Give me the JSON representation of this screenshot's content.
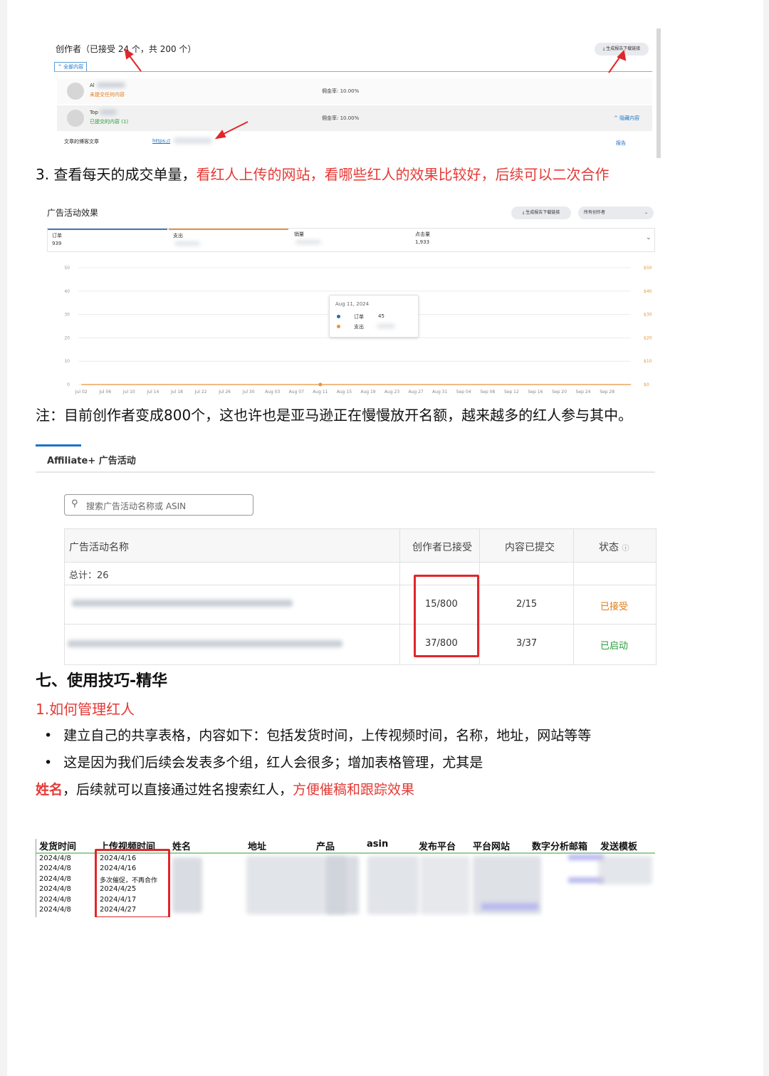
{
  "creators_panel": {
    "title": "创作者（已接受 24 个，共 200 个）",
    "report_button": "生成报告下载链接",
    "filter_tab": "^ 全部内容",
    "rows": [
      {
        "name": "Al",
        "status": "未提交任何内容",
        "commission": "佣金率: 10.00%"
      },
      {
        "name": "Top",
        "status": "已提交的内容 (1)",
        "commission": "佣金率: 10.00%",
        "action": "^ 隐藏内容"
      }
    ],
    "article_label": "文章的博客文章",
    "article_link": "https://",
    "article_action": "报告"
  },
  "section3_text": {
    "prefix": "3. 查看每天的成交单量，",
    "red": "看红人上传的网站，看哪些红人的效果比较好，后续可以二次合作"
  },
  "chart_panel": {
    "title": "广告活动效果",
    "report_button": "生成报告下载链接",
    "creator_select": "所有创作者",
    "metrics": [
      {
        "label": "订单",
        "value": "939"
      },
      {
        "label": "支出",
        "value": ""
      },
      {
        "label": "销量",
        "value": ""
      },
      {
        "label": "点击量",
        "value": "1,933"
      }
    ],
    "tooltip": {
      "date": "Aug 11, 2024",
      "series1": "订单",
      "value1": "45",
      "series2": "支出"
    }
  },
  "chart_data": {
    "type": "bar",
    "title": "广告活动效果",
    "x_tick_labels": [
      "Jul 02",
      "Jul 06",
      "Jul 10",
      "Jul 14",
      "Jul 18",
      "Jul 22",
      "Jul 26",
      "Jul 30",
      "Aug 03",
      "Aug 07",
      "Aug 11",
      "Aug 15",
      "Aug 19",
      "Aug 23",
      "Aug 27",
      "Aug 31",
      "Sep 04",
      "Sep 08",
      "Sep 12",
      "Sep 16",
      "Sep 20",
      "Sep 24",
      "Sep 28"
    ],
    "y_left_ticks": [
      "0",
      "10",
      "20",
      "30",
      "40",
      "50"
    ],
    "y_right_ticks": [
      "$0",
      "$10",
      "$20",
      "$30",
      "$40",
      "$50"
    ],
    "ylim": [
      0,
      50
    ],
    "series": [
      {
        "name": "订单",
        "kind": "bar",
        "color": "#8fb3cf",
        "values": [
          0,
          0,
          0,
          0,
          0,
          0,
          0,
          0,
          0,
          0,
          0,
          0,
          0,
          0,
          0,
          0,
          0,
          0,
          0,
          0,
          0,
          0,
          0,
          0,
          0,
          0,
          0,
          0,
          0,
          0,
          0,
          0,
          0,
          0,
          0,
          0,
          0,
          0,
          0,
          0,
          0,
          0,
          0,
          0,
          0,
          0,
          0,
          0,
          0,
          0,
          0,
          0,
          0,
          0,
          0,
          0,
          0,
          0,
          0,
          0,
          0,
          0,
          0,
          0,
          0,
          0,
          0,
          0,
          0,
          0,
          0,
          0,
          0,
          0,
          0,
          0,
          0,
          0,
          0,
          0,
          0,
          0,
          0,
          0,
          0,
          0,
          0,
          0,
          0,
          0,
          0,
          0
        ]
      },
      {
        "name": "支出",
        "kind": "line",
        "color": "#e8953a",
        "values": [
          0,
          0,
          0,
          0,
          0,
          0,
          0,
          0,
          0,
          0,
          0,
          0,
          0,
          0,
          0,
          0,
          0,
          0,
          0,
          0,
          0,
          0,
          0,
          0,
          0,
          0,
          0,
          0,
          0,
          0,
          0,
          0,
          0,
          0,
          0,
          0,
          0,
          0,
          0,
          0,
          0,
          0,
          0,
          0,
          0,
          0,
          0,
          0,
          0,
          0,
          0,
          0,
          0,
          0,
          0,
          0,
          0,
          0,
          0,
          0,
          0,
          0,
          0,
          0,
          0,
          0,
          0,
          0,
          0,
          0,
          0,
          0,
          0,
          0,
          0,
          0,
          0,
          0,
          0,
          0,
          0,
          0,
          0,
          0,
          0,
          0,
          0,
          0,
          0,
          0,
          0,
          0,
          0
        ]
      }
    ]
  },
  "note_text": "注：目前创作者变成800个，这也许也是亚马逊正在慢慢放开名额，越来越多的红人参与其中。",
  "affiliate_panel": {
    "title": "Affiliate+ 广告活动",
    "search_placeholder": "搜索广告活动名称或 ASIN",
    "columns": [
      "广告活动名称",
      "创作者已接受",
      "内容已提交",
      "状态"
    ],
    "total": "总计：26",
    "rows": [
      {
        "accepted": "15/800",
        "submitted": "2/15",
        "status": "已接受",
        "status_color": "#e07b17"
      },
      {
        "accepted": "37/800",
        "submitted": "3/37",
        "status": "已启动",
        "status_color": "#2a9a3a"
      }
    ]
  },
  "section7": {
    "heading": "七、使用技巧-精华",
    "sub": "1.如何管理红人",
    "bullet1": "建立自己的共享表格，内容如下：包括发货时间，上传视频时间，名称，地址，网站等等",
    "bullet2": "这是因为我们后续会发表多个组，红人会很多；增加表格管理，尤其是",
    "line3_red1": "姓名",
    "line3_mid": "，后续就可以直接通过姓名搜索红人，",
    "line3_red2": "方便催稿和跟踪效果"
  },
  "sheet": {
    "headers": [
      "发货时间",
      "上传视频时间",
      "姓名",
      "地址",
      "产品",
      "asin",
      "发布平台",
      "平台网站",
      "数字分析邮箱",
      "发送模板"
    ],
    "rows": [
      [
        "2024/4/8",
        "2024/4/16"
      ],
      [
        "2024/4/8",
        "2024/4/16"
      ],
      [
        "2024/4/8",
        "多次催促，不再合作"
      ],
      [
        "2024/4/8",
        "2024/4/25"
      ],
      [
        "2024/4/8",
        "2024/4/17"
      ],
      [
        "2024/4/8",
        "2024/4/27"
      ]
    ]
  }
}
